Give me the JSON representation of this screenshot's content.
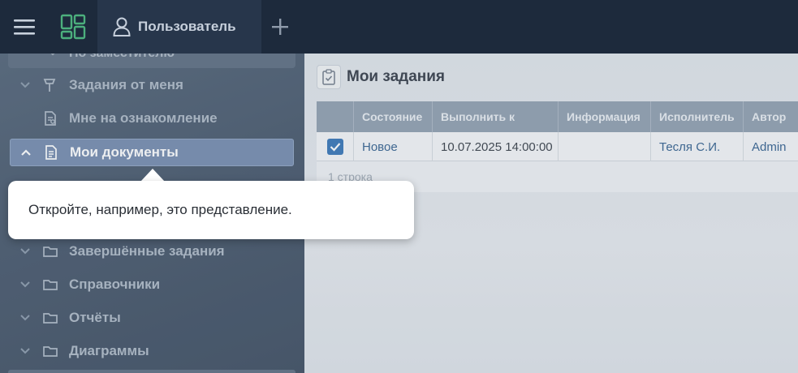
{
  "topbar": {
    "menu_icon": "hamburger-icon",
    "dashboard_icon": "dashboard-grid-icon",
    "user_tab_label": "Пользователь",
    "add_icon": "plus-icon"
  },
  "sidebar": {
    "cut_item_label": "По заместителю",
    "items": [
      {
        "label": "Задания от меня",
        "icon": "pin-icon",
        "chevron": "chevron-down"
      },
      {
        "label": "Мне на ознакомление",
        "icon": "document-review-icon",
        "chevron": ""
      },
      {
        "label": "Мои документы",
        "icon": "document-icon",
        "chevron": "chevron-up"
      },
      {
        "label": "Завершённые задания",
        "icon": "folder-icon",
        "chevron": "chevron-down"
      },
      {
        "label": "Справочники",
        "icon": "folder-icon",
        "chevron": "chevron-down"
      },
      {
        "label": "Отчёты",
        "icon": "folder-icon",
        "chevron": "chevron-down"
      },
      {
        "label": "Диаграммы",
        "icon": "folder-icon",
        "chevron": "chevron-down"
      }
    ]
  },
  "main": {
    "title": "Мои задания",
    "title_icon": "clipboard-check-icon",
    "grid": {
      "columns": [
        "Состояние",
        "Выполнить к",
        "Информация",
        "Исполнитель",
        "Автор"
      ],
      "rows": [
        {
          "checked": true,
          "state": "Новое",
          "due": "10.07.2025 14:00:00",
          "info": "",
          "executor": "Тесля С.И.",
          "author": "Admin"
        }
      ],
      "footer": "1 строка"
    }
  },
  "tooltip": {
    "text": "Откройте, например, это представление."
  },
  "colors": {
    "topbar": "#1d2a3c",
    "active_item": "#6f87ab",
    "link": "#2b5a8a",
    "checkbox": "#2f6fb4"
  }
}
